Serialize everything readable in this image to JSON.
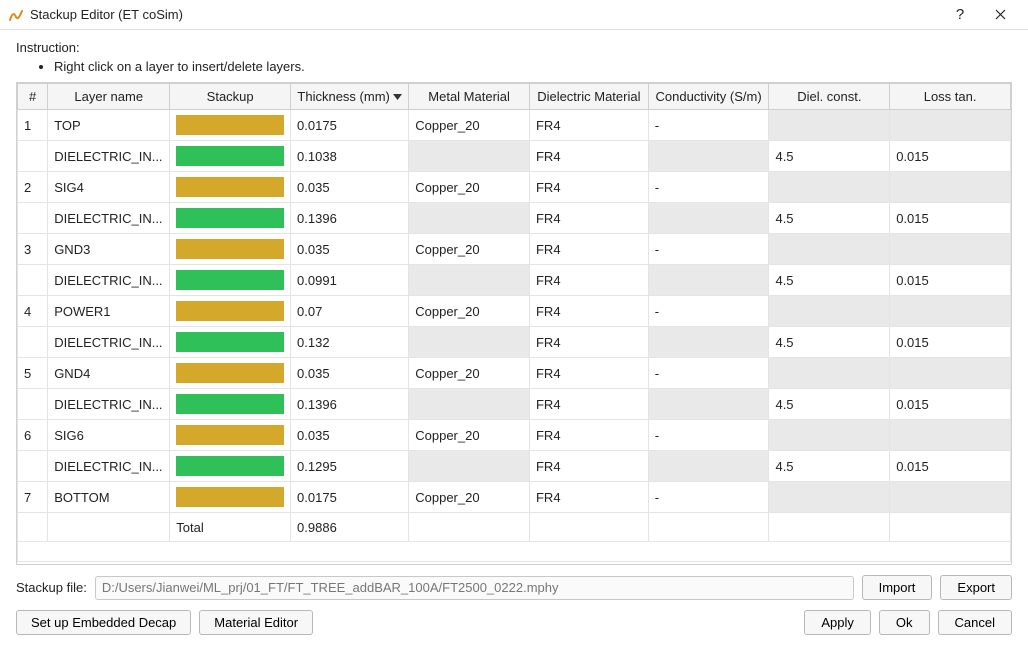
{
  "window": {
    "title": "Stackup Editor (ET coSim)"
  },
  "instruction": {
    "label": "Instruction:",
    "items": [
      "Right click on a layer to insert/delete layers."
    ]
  },
  "columns": {
    "num": "#",
    "layer_name": "Layer name",
    "stackup": "Stackup",
    "thickness": "Thickness (mm)",
    "metal_material": "Metal Material",
    "dielectric_material": "Dielectric Material",
    "conductivity": "Conductivity (S/m)",
    "diel_const": "Diel. const.",
    "loss_tan": "Loss tan."
  },
  "rows": [
    {
      "num": "1",
      "name": "TOP",
      "kind": "metal",
      "thickness": "0.0175",
      "metal": "Copper_20",
      "diel": "FR4",
      "cond": "-",
      "dc": "",
      "lt": ""
    },
    {
      "num": "",
      "name": "DIELECTRIC_IN...",
      "kind": "diel",
      "thickness": "0.1038",
      "metal": "",
      "diel": "FR4",
      "cond": "",
      "dc": "4.5",
      "lt": "0.015"
    },
    {
      "num": "2",
      "name": "SIG4",
      "kind": "metal",
      "thickness": "0.035",
      "metal": "Copper_20",
      "diel": "FR4",
      "cond": "-",
      "dc": "",
      "lt": ""
    },
    {
      "num": "",
      "name": "DIELECTRIC_IN...",
      "kind": "diel",
      "thickness": "0.1396",
      "metal": "",
      "diel": "FR4",
      "cond": "",
      "dc": "4.5",
      "lt": "0.015"
    },
    {
      "num": "3",
      "name": "GND3",
      "kind": "metal",
      "thickness": "0.035",
      "metal": "Copper_20",
      "diel": "FR4",
      "cond": "-",
      "dc": "",
      "lt": ""
    },
    {
      "num": "",
      "name": "DIELECTRIC_IN...",
      "kind": "diel",
      "thickness": "0.0991",
      "metal": "",
      "diel": "FR4",
      "cond": "",
      "dc": "4.5",
      "lt": "0.015"
    },
    {
      "num": "4",
      "name": "POWER1",
      "kind": "metal",
      "thickness": "0.07",
      "metal": "Copper_20",
      "diel": "FR4",
      "cond": "-",
      "dc": "",
      "lt": ""
    },
    {
      "num": "",
      "name": "DIELECTRIC_IN...",
      "kind": "diel",
      "thickness": "0.132",
      "metal": "",
      "diel": "FR4",
      "cond": "",
      "dc": "4.5",
      "lt": "0.015"
    },
    {
      "num": "5",
      "name": "GND4",
      "kind": "metal",
      "thickness": "0.035",
      "metal": "Copper_20",
      "diel": "FR4",
      "cond": "-",
      "dc": "",
      "lt": ""
    },
    {
      "num": "",
      "name": "DIELECTRIC_IN...",
      "kind": "diel",
      "thickness": "0.1396",
      "metal": "",
      "diel": "FR4",
      "cond": "",
      "dc": "4.5",
      "lt": "0.015"
    },
    {
      "num": "6",
      "name": "SIG6",
      "kind": "metal",
      "thickness": "0.035",
      "metal": "Copper_20",
      "diel": "FR4",
      "cond": "-",
      "dc": "",
      "lt": ""
    },
    {
      "num": "",
      "name": "DIELECTRIC_IN...",
      "kind": "diel",
      "thickness": "0.1295",
      "metal": "",
      "diel": "FR4",
      "cond": "",
      "dc": "4.5",
      "lt": "0.015"
    },
    {
      "num": "7",
      "name": "BOTTOM",
      "kind": "metal",
      "thickness": "0.0175",
      "metal": "Copper_20",
      "diel": "FR4",
      "cond": "-",
      "dc": "",
      "lt": ""
    }
  ],
  "total_row": {
    "name": "Total",
    "thickness": "0.9886"
  },
  "file": {
    "label": "Stackup file:",
    "path": "D:/Users/Jianwei/ML_prj/01_FT/FT_TREE_addBAR_100A/FT2500_0222.mphy"
  },
  "buttons": {
    "import": "Import",
    "export": "Export",
    "embedded_decap": "Set up Embedded Decap",
    "material_editor": "Material Editor",
    "apply": "Apply",
    "ok": "Ok",
    "cancel": "Cancel"
  }
}
